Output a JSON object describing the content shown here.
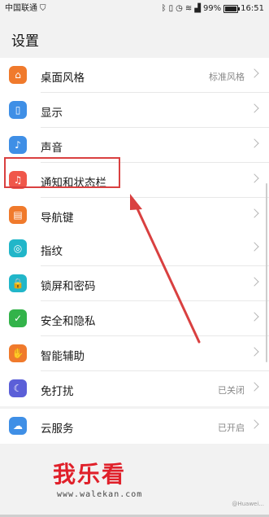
{
  "status_bar": {
    "carrier": "中国联通",
    "battery_percent": "99%",
    "battery_level": 0.99,
    "time": "16:51",
    "icons": [
      "shield-icon",
      "bluetooth-icon",
      "vibrate-icon",
      "alarm-icon",
      "wifi-icon",
      "signal-icon",
      "battery-icon"
    ]
  },
  "header": {
    "title": "设置"
  },
  "groups": [
    {
      "items": [
        {
          "label": "桌面风格",
          "value": "标准风格",
          "icon": "home-icon",
          "color": "#f07a2c"
        },
        {
          "label": "显示",
          "value": "",
          "icon": "phone-display-icon",
          "color": "#3f8fe6"
        },
        {
          "label": "声音",
          "value": "",
          "icon": "speaker-icon",
          "color": "#3f8fe6"
        },
        {
          "label": "通知和状态栏",
          "value": "",
          "icon": "bell-icon",
          "color": "#f0574a"
        },
        {
          "label": "导航键",
          "value": "",
          "icon": "navigation-keys-icon",
          "color": "#f07a2c"
        }
      ]
    },
    {
      "items": [
        {
          "label": "指纹",
          "value": "",
          "icon": "fingerprint-icon",
          "color": "#21b6c9"
        },
        {
          "label": "锁屏和密码",
          "value": "",
          "icon": "lock-icon",
          "color": "#21b6c9"
        },
        {
          "label": "安全和隐私",
          "value": "",
          "icon": "shield-check-icon",
          "color": "#33b34a"
        },
        {
          "label": "智能辅助",
          "value": "",
          "icon": "hand-icon",
          "color": "#f07a2c"
        },
        {
          "label": "免打扰",
          "value": "已关闭",
          "icon": "moon-icon",
          "color": "#5b5fd8"
        }
      ]
    },
    {
      "items": [
        {
          "label": "云服务",
          "value": "已开启",
          "icon": "cloud-icon",
          "color": "#3f8fe6"
        }
      ]
    }
  ],
  "watermark": {
    "title": "我乐看",
    "url": "www.walekan.com",
    "corner": "@Huawei..."
  }
}
